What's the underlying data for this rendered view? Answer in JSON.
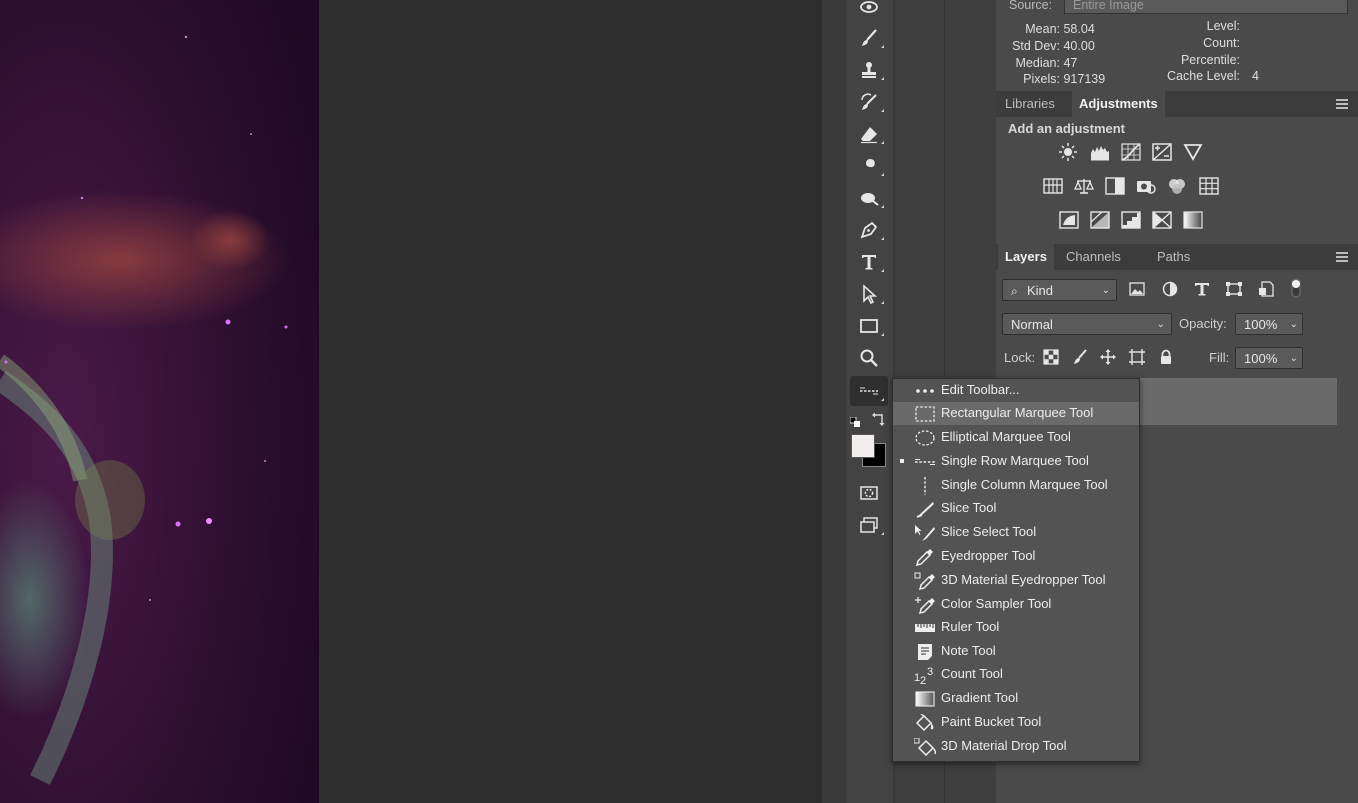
{
  "histogram": {
    "source_label": "Source:",
    "source_value": "Entire Image",
    "mean_label": "Mean:",
    "mean": "58.04",
    "stddev_label": "Std Dev:",
    "stddev": "40.00",
    "median_label": "Median:",
    "median": "47",
    "pixels_label": "Pixels:",
    "pixels": "917139",
    "level_label": "Level:",
    "count_label": "Count:",
    "percentile_label": "Percentile:",
    "cache_label": "Cache Level:",
    "cache": "4"
  },
  "adjust_tabs": {
    "libraries": "Libraries",
    "adjustments": "Adjustments"
  },
  "adjust_heading": "Add an adjustment",
  "layer_tabs": {
    "layers": "Layers",
    "channels": "Channels",
    "paths": "Paths"
  },
  "layers": {
    "kind": "Kind",
    "blend_mode": "Normal",
    "opacity_label": "Opacity:",
    "opacity": "100%",
    "lock_label": "Lock:",
    "fill_label": "Fill:",
    "fill": "100%"
  },
  "flyout": {
    "items": [
      {
        "label": "Edit Toolbar...",
        "icon": "dots-icon"
      },
      {
        "label": "Rectangular Marquee Tool",
        "icon": "rect-marquee-icon"
      },
      {
        "label": "Elliptical Marquee Tool",
        "icon": "ellipse-marquee-icon"
      },
      {
        "label": "Single Row Marquee Tool",
        "icon": "single-row-marquee-icon"
      },
      {
        "label": "Single Column Marquee Tool",
        "icon": "single-column-marquee-icon"
      },
      {
        "label": "Slice Tool",
        "icon": "slice-icon"
      },
      {
        "label": "Slice Select Tool",
        "icon": "slice-select-icon"
      },
      {
        "label": "Eyedropper Tool",
        "icon": "eyedropper-icon"
      },
      {
        "label": "3D Material Eyedropper Tool",
        "icon": "3d-eyedropper-icon"
      },
      {
        "label": "Color Sampler Tool",
        "icon": "color-sampler-icon"
      },
      {
        "label": "Ruler Tool",
        "icon": "ruler-icon"
      },
      {
        "label": "Note Tool",
        "icon": "note-icon"
      },
      {
        "label": "Count Tool",
        "icon": "count-icon"
      },
      {
        "label": "Gradient Tool",
        "icon": "gradient-icon"
      },
      {
        "label": "Paint Bucket Tool",
        "icon": "paint-bucket-icon"
      },
      {
        "label": "3D Material Drop Tool",
        "icon": "3d-drop-icon"
      }
    ],
    "highlighted": "Rectangular Marquee Tool",
    "current": "Single Row Marquee Tool",
    "count_icon_text": "1 2 3"
  },
  "colors": {
    "panel": "#4a4a4a",
    "toolbar": "#434343",
    "highlight": "#6a6a6a",
    "foreground": "#f2eeee",
    "background": "#000000"
  }
}
